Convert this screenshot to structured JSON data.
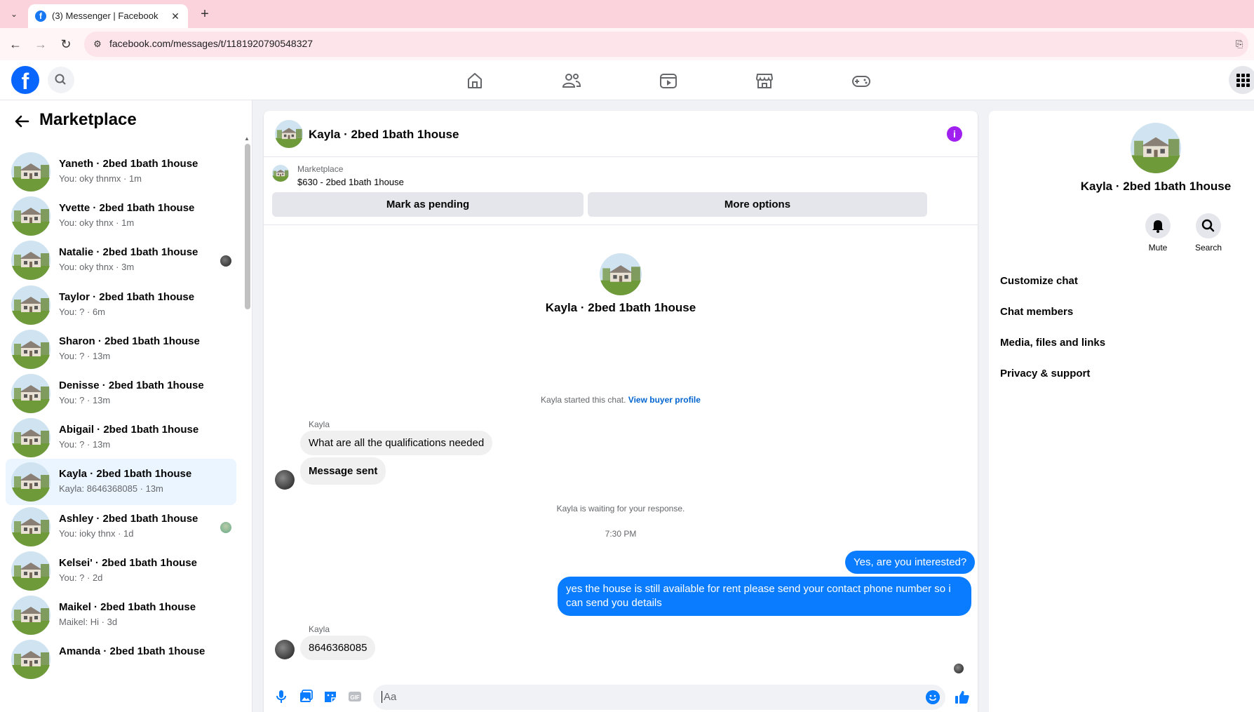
{
  "browser": {
    "tab_title": "(3) Messenger | Facebook",
    "url": "facebook.com/messages/t/1181920790548327"
  },
  "colors": {
    "accent": "#0a7cff",
    "fb_blue": "#0866ff",
    "info": "#a020f0",
    "active_row": "#ebf5ff"
  },
  "sidebar": {
    "title": "Marketplace",
    "conversations": [
      {
        "name": "Yaneth · 2bed 1bath 1house",
        "sub": "You: oky thnmx · 1m",
        "seen": ""
      },
      {
        "name": "Yvette · 2bed 1bath 1house",
        "sub": "You: oky thnx · 1m",
        "seen": ""
      },
      {
        "name": "Natalie · 2bed 1bath 1house",
        "sub": "You: oky thnx · 3m",
        "seen": "dark"
      },
      {
        "name": "Taylor · 2bed 1bath 1house",
        "sub": "You: ? · 6m",
        "seen": ""
      },
      {
        "name": "Sharon · 2bed 1bath 1house",
        "sub": "You: ? · 13m",
        "seen": ""
      },
      {
        "name": "Denisse · 2bed 1bath 1house",
        "sub": "You: ? · 13m",
        "seen": ""
      },
      {
        "name": "Abigail · 2bed 1bath 1house",
        "sub": "You: ? · 13m",
        "seen": ""
      },
      {
        "name": "Kayla · 2bed 1bath 1house",
        "sub": "Kayla: 8646368085 · 13m",
        "seen": "",
        "active": true
      },
      {
        "name": "Ashley · 2bed 1bath 1house",
        "sub": "You: ioky thnx · 1d",
        "seen": "house"
      },
      {
        "name": "Kelsei' · 2bed 1bath 1house",
        "sub": "You: ? · 2d",
        "seen": ""
      },
      {
        "name": "Maikel · 2bed 1bath 1house",
        "sub": "Maikel: Hi · 3d",
        "seen": ""
      },
      {
        "name": "Amanda · 2bed 1bath 1house",
        "sub": "",
        "seen": ""
      }
    ]
  },
  "chat": {
    "header_name": "Kayla · 2bed 1bath 1house",
    "listing_source": "Marketplace",
    "listing_title": "$630 - 2bed 1bath 1house",
    "mark_pending": "Mark as pending",
    "more_options": "More options",
    "intro_name": "Kayla · 2bed 1bath 1house",
    "started_text": "Kayla started this chat.",
    "view_buyer": "View buyer profile",
    "sender_1": "Kayla",
    "msg_1": "What are all the qualifications needed",
    "msg_2": "Message sent",
    "waiting": "Kayla is waiting for your response.",
    "time": "7:30 PM",
    "out_1": "Yes, are you interested?",
    "out_2": "yes the house is still available for rent please send your contact phone number so i can send you details",
    "sender_2": "Kayla",
    "msg_3": "8646368085",
    "composer_placeholder": "Aa"
  },
  "right": {
    "name": "Kayla · 2bed 1bath 1house",
    "mute": "Mute",
    "search": "Search",
    "items": [
      "Customize chat",
      "Chat members",
      "Media, files and links",
      "Privacy & support"
    ]
  }
}
